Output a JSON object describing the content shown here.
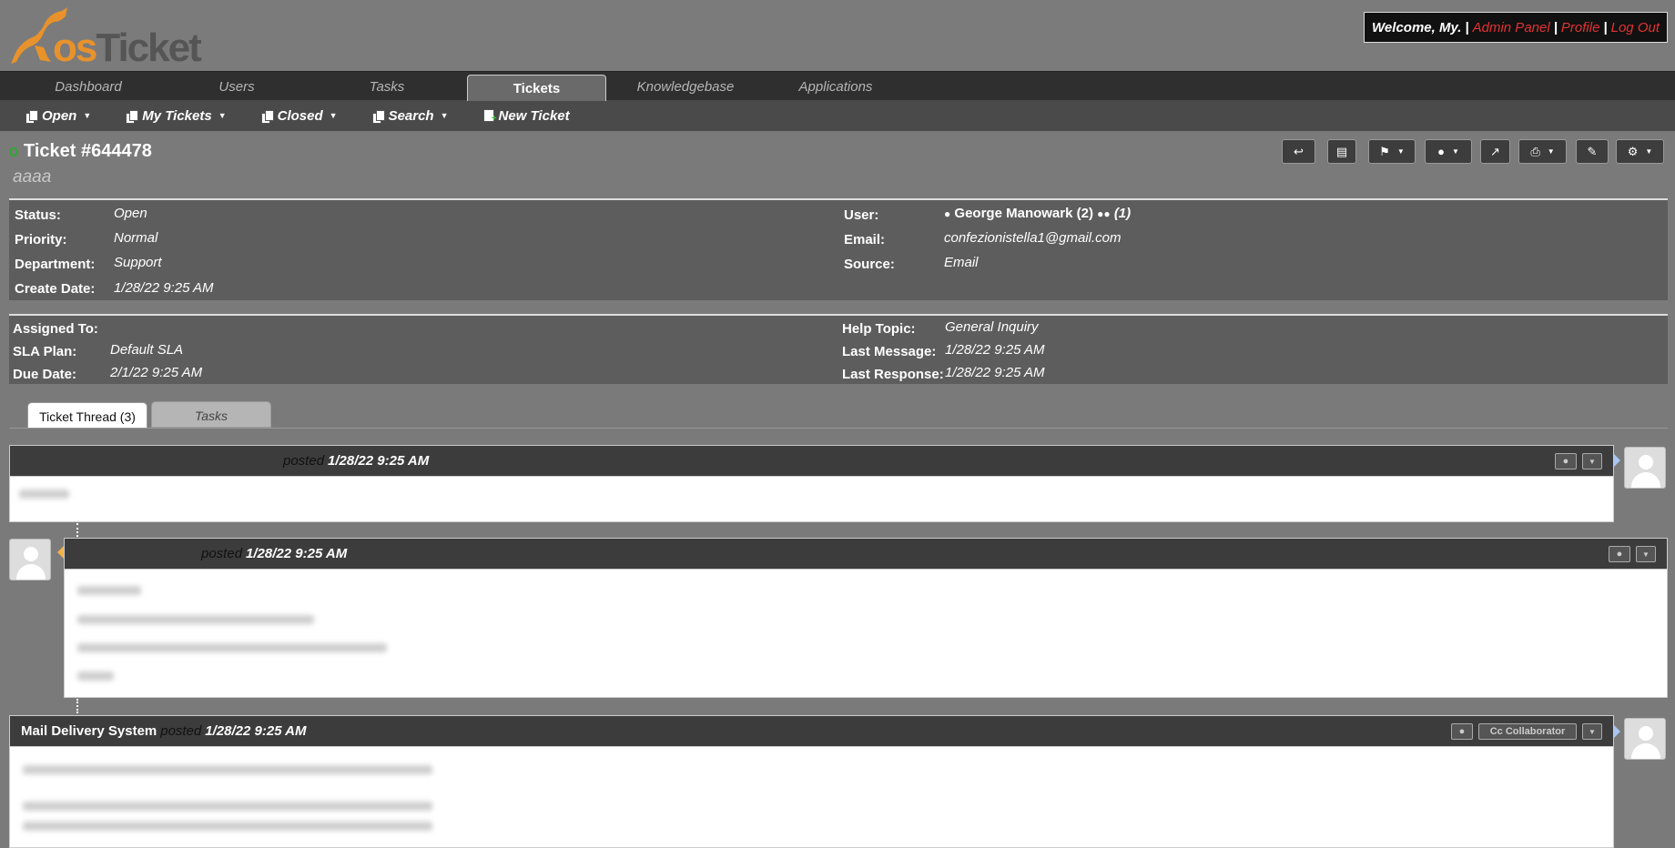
{
  "header": {
    "logo_text": "osTicket",
    "welcome": "Welcome, My.",
    "sep": "|",
    "admin_panel": "Admin Panel",
    "profile": "Profile",
    "logout": "Log Out"
  },
  "nav": {
    "tabs": [
      "Dashboard",
      "Users",
      "Tasks",
      "Tickets",
      "Knowledgebase",
      "Applications"
    ],
    "active": "Tickets"
  },
  "subnav": {
    "open": "Open",
    "my_tickets": "My Tickets",
    "closed": "Closed",
    "search": "Search",
    "new_ticket": "New Ticket"
  },
  "ticket": {
    "title": "Ticket #644478",
    "subject": "aaaa"
  },
  "info_left": {
    "status_label": "Status:",
    "status": "Open",
    "priority_label": "Priority:",
    "priority": "Normal",
    "department_label": "Department:",
    "department": "Support",
    "create_label": "Create Date:",
    "create_date": "1/28/22 9:25 AM"
  },
  "info_right": {
    "user_label": "User:",
    "user": "George Manowark (2)",
    "collab_count": "(1)",
    "email_label": "Email:",
    "email": "confezionistella1@gmail.com",
    "source_label": "Source:",
    "source": "Email"
  },
  "info2_left": {
    "assigned_label": "Assigned To:",
    "sla_label": "SLA Plan:",
    "sla": "Default SLA",
    "due_label": "Due Date:",
    "due": "2/1/22 9:25 AM"
  },
  "info2_right": {
    "topic_label": "Help Topic:",
    "topic": "General Inquiry",
    "last_msg_label": "Last Message:",
    "last_msg": "1/28/22 9:25 AM",
    "last_resp_label": "Last Response:",
    "last_resp": "1/28/22 9:25 AM"
  },
  "thread_tabs": {
    "thread": "Ticket Thread (3)",
    "tasks": "Tasks"
  },
  "entries": [
    {
      "poster": "",
      "posted": "posted",
      "date": "1/28/22 9:25 AM"
    },
    {
      "poster": "",
      "posted": "posted",
      "date": "1/28/22 9:25 AM"
    },
    {
      "poster": "Mail Delivery System",
      "posted": "posted",
      "date": "1/28/22 9:25 AM",
      "cc": "Cc Collaborator"
    }
  ],
  "colors": {
    "accent": "#e23333",
    "status_dot": "#2ea82e",
    "bg": "#7a7a7a"
  }
}
